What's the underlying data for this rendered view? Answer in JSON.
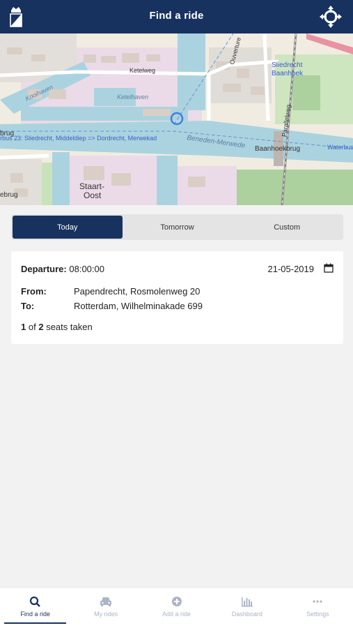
{
  "header": {
    "title": "Find a ride"
  },
  "map": {
    "labels": {
      "ketelweg": "Ketelweg",
      "ketelhaven": "Ketelhaven",
      "kooihaven": "Kooihaven",
      "overture": "Ouverture",
      "sliedrecht": "Sliedrecht",
      "baanhoek": "Baanhoek",
      "beneden": "Beneden-Merwede",
      "baanhoekbrug": "Baanhoekbrug",
      "waterbus": "Waterbus",
      "ferry": "rbus 23: Sliedrecht, Middeldiep => Dordrecht, Merwekad",
      "staart1": "Staart-",
      "staart2": "Oost",
      "brug_left": "brug",
      "brug_left2": "ebrug",
      "paralleweg": "Parallelweg"
    }
  },
  "tabs_day": {
    "today": "Today",
    "tomorrow": "Tomorrow",
    "custom": "Custom"
  },
  "ride": {
    "departure_label": "Departure:",
    "departure_time": "08:00:00",
    "date": "21-05-2019",
    "from_label": "From:",
    "from_value": "Papendrecht, Rosmolenweg 20",
    "to_label": "To:",
    "to_value": "Rotterdam, Wilhelminakade 699",
    "seats_taken": "1",
    "seats_of": "of",
    "seats_total": "2",
    "seats_suffix": "seats taken"
  },
  "tabbar": {
    "find": "Find a ride",
    "my": "My rides",
    "add": "Add a ride",
    "dashboard": "Dashboard",
    "settings": "Settings"
  },
  "colors": {
    "primary": "#17325f",
    "water": "#aad3df",
    "industrial": "#ebdbe8",
    "park": "#add19e"
  }
}
